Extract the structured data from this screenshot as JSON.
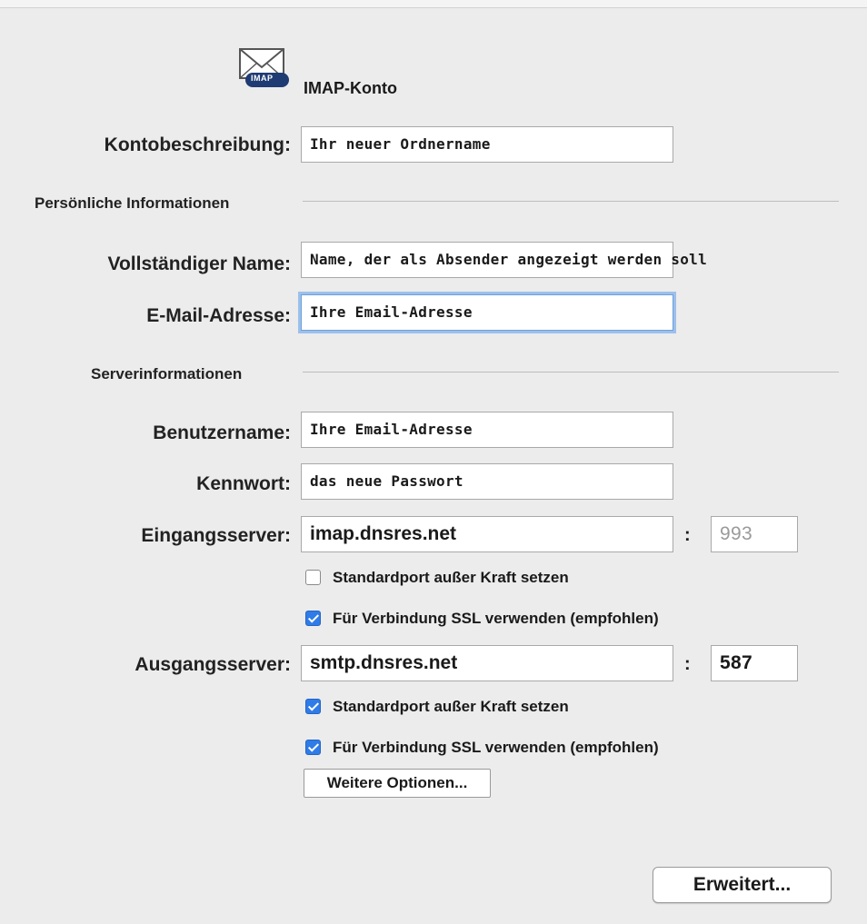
{
  "account": {
    "type_label": "IMAP-Konto",
    "icon_badge": "IMAP",
    "icon": "mail-envelope-icon"
  },
  "description": {
    "label": "Kontobeschreibung:",
    "value": "Ihr neuer Ordnername"
  },
  "personal": {
    "section_title": "Persönliche Informationen",
    "full_name": {
      "label": "Vollständiger Name:",
      "value": "Name, der als Absender angezeigt werden soll"
    },
    "email": {
      "label": "E-Mail-Adresse:",
      "value": "Ihre Email-Adresse"
    }
  },
  "server": {
    "section_title": "Serverinformationen",
    "username": {
      "label": "Benutzername:",
      "value": "Ihre Email-Adresse"
    },
    "password": {
      "label": "Kennwort:",
      "value": "das neue Passwort"
    },
    "incoming": {
      "label": "Eingangsserver:",
      "value": "imap.dnsres.net",
      "port_separator": ":",
      "port": "993",
      "override_port": {
        "label": "Standardport außer Kraft setzen",
        "checked": false
      },
      "use_ssl": {
        "label": "Für Verbindung SSL verwenden (empfohlen)",
        "checked": true
      }
    },
    "outgoing": {
      "label": "Ausgangsserver:",
      "value": "smtp.dnsres.net",
      "port_separator": ":",
      "port": "587",
      "override_port": {
        "label": "Standardport außer Kraft setzen",
        "checked": true
      },
      "use_ssl": {
        "label": "Für Verbindung SSL verwenden (empfohlen)",
        "checked": true
      }
    },
    "more_options_button": "Weitere Optionen..."
  },
  "advanced_button": "Erweitert...",
  "colors": {
    "checkbox_accent": "#2f7ce8",
    "focus_ring": "#9cc0ec",
    "background": "#ececec"
  }
}
